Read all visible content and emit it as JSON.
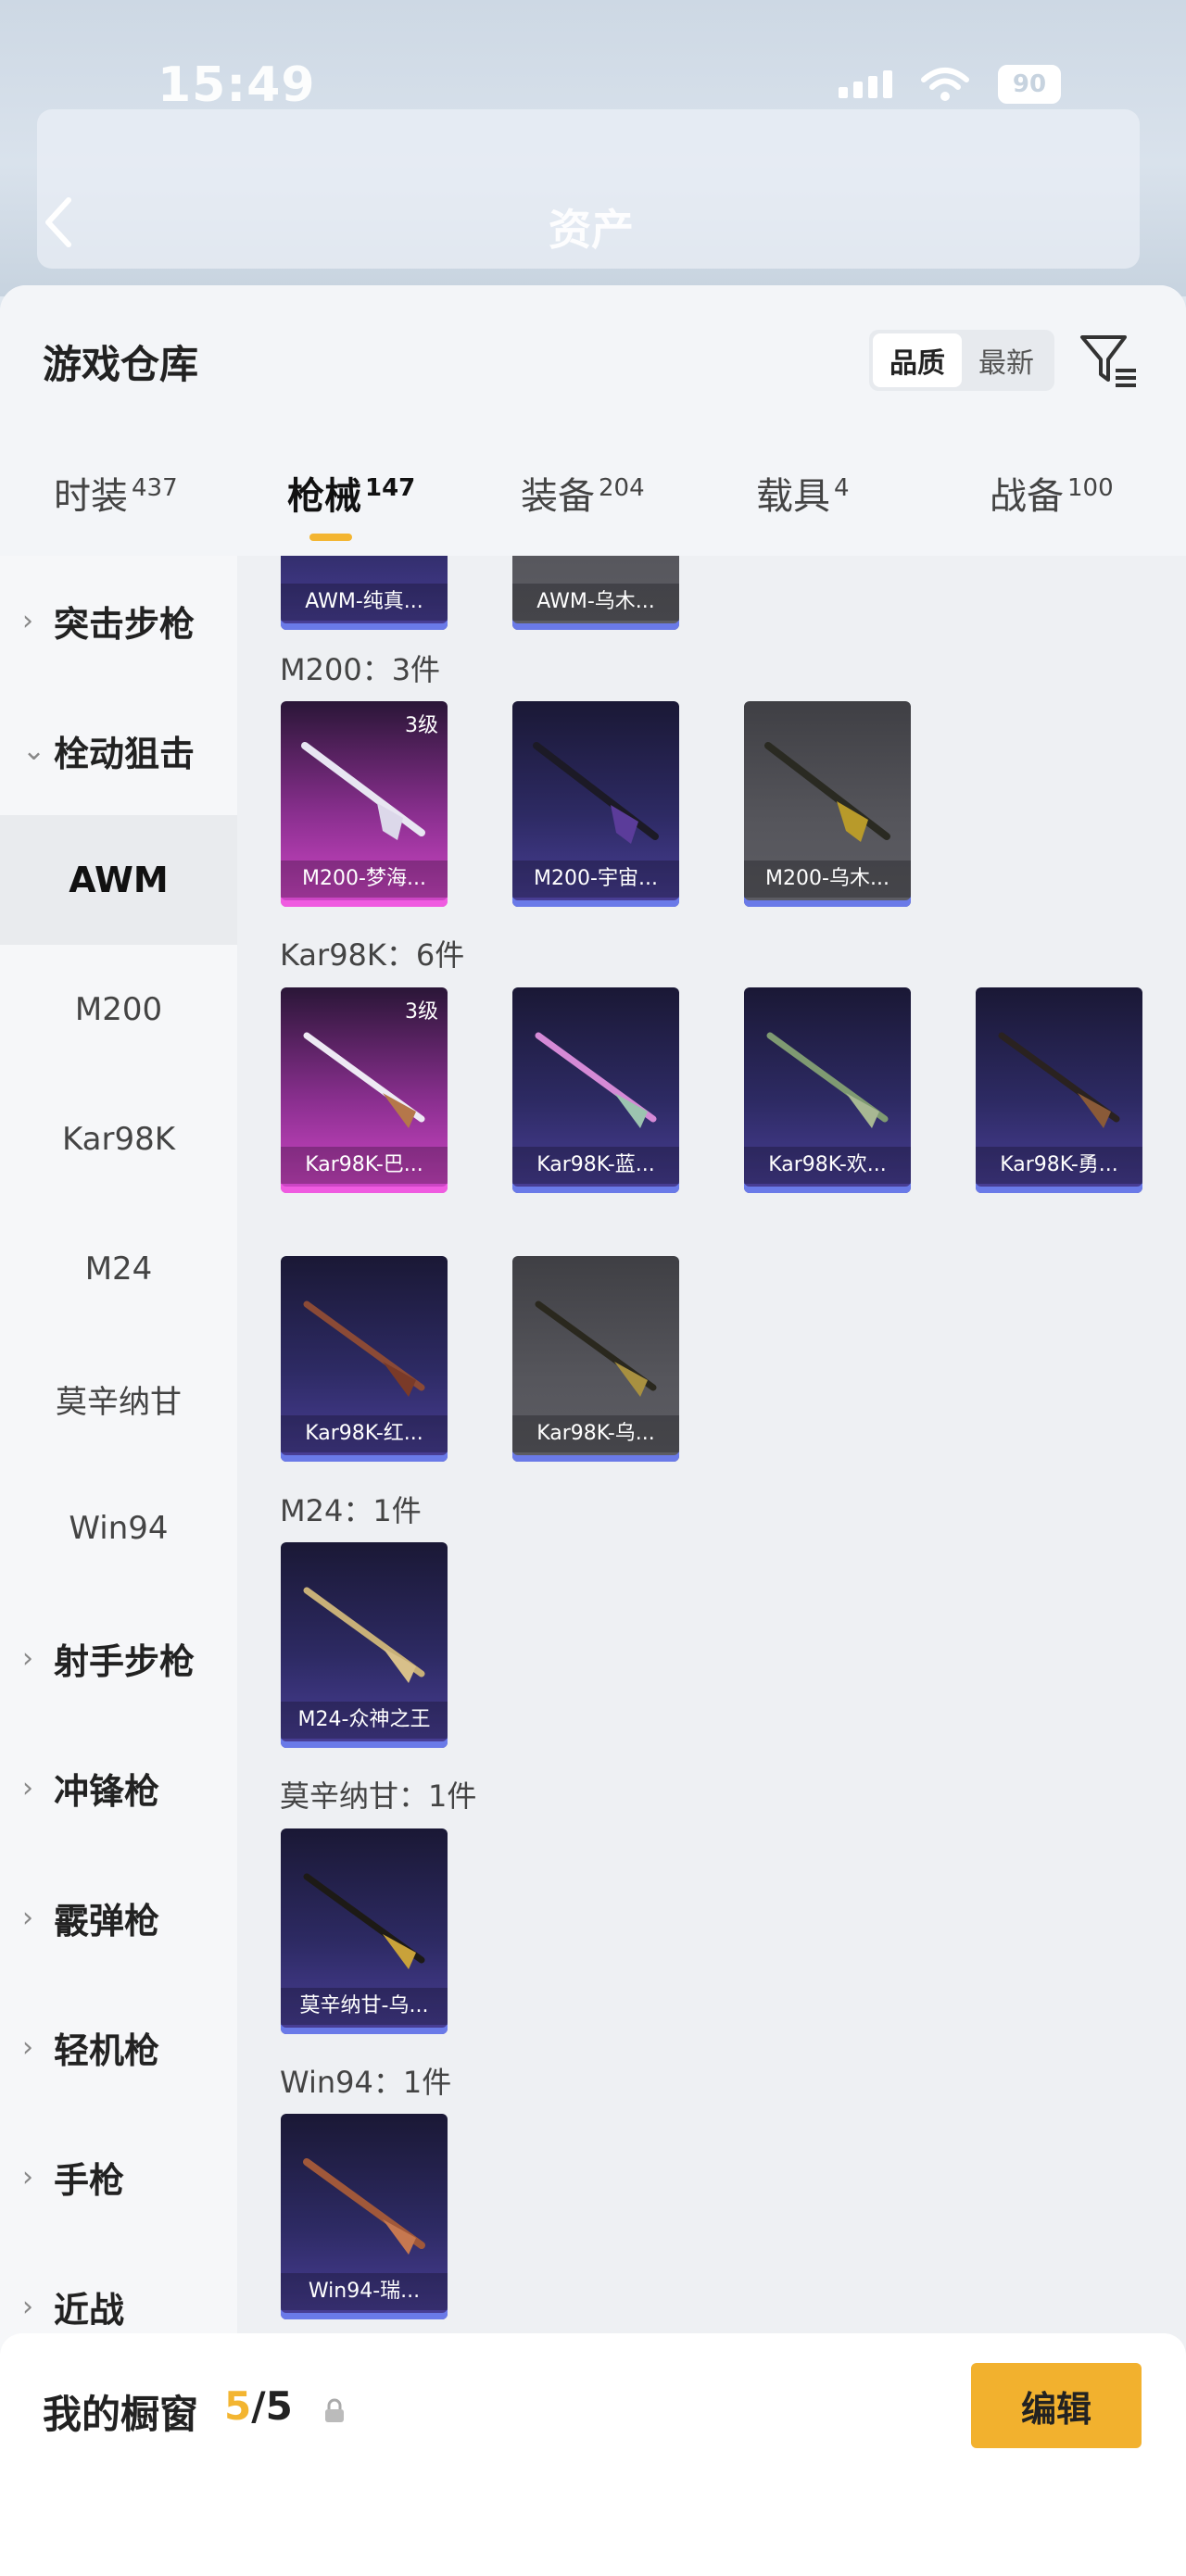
{
  "status_bar": {
    "time": "15:49",
    "battery": "90"
  },
  "nav": {
    "title": "资产"
  },
  "sheet": {
    "title": "游戏仓库"
  },
  "sort": {
    "options": [
      "品质",
      "最新"
    ],
    "active": "品质"
  },
  "tabs": [
    {
      "label": "时装",
      "count": "437"
    },
    {
      "label": "枪械",
      "count": "147",
      "active": true
    },
    {
      "label": "装备",
      "count": "204"
    },
    {
      "label": "载具",
      "count": "4"
    },
    {
      "label": "战备",
      "count": "100"
    }
  ],
  "sidebar": {
    "items": [
      {
        "label": "突击步枪",
        "type": "category",
        "expanded": false
      },
      {
        "label": "栓动狙击",
        "type": "category",
        "expanded": true
      },
      {
        "label": "AWM",
        "type": "sub",
        "selected": true
      },
      {
        "label": "M200",
        "type": "sub"
      },
      {
        "label": "Kar98K",
        "type": "sub"
      },
      {
        "label": "M24",
        "type": "sub"
      },
      {
        "label": "莫辛纳甘",
        "type": "sub"
      },
      {
        "label": "Win94",
        "type": "sub"
      },
      {
        "label": "射手步枪",
        "type": "category",
        "expanded": false
      },
      {
        "label": "冲锋枪",
        "type": "category",
        "expanded": false
      },
      {
        "label": "霰弹枪",
        "type": "category",
        "expanded": false
      },
      {
        "label": "轻机枪",
        "type": "category",
        "expanded": false
      },
      {
        "label": "手枪",
        "type": "category",
        "expanded": false
      },
      {
        "label": "近战",
        "type": "category",
        "expanded": false
      }
    ]
  },
  "content": {
    "partial_items": [
      {
        "name": "AWM-纯真...",
        "rarity": "purple"
      },
      {
        "name": "AWM-乌木...",
        "rarity": "grey"
      }
    ],
    "groups": [
      {
        "title": "M200：3件",
        "items": [
          {
            "name": "M200-梦海...",
            "rarity": "pink",
            "level": "3级"
          },
          {
            "name": "M200-宇宙...",
            "rarity": "purple"
          },
          {
            "name": "M200-乌木...",
            "rarity": "grey"
          }
        ]
      },
      {
        "title": "Kar98K：6件",
        "items": [
          {
            "name": "Kar98K-巴...",
            "rarity": "pink",
            "level": "3级"
          },
          {
            "name": "Kar98K-蓝...",
            "rarity": "purple"
          },
          {
            "name": "Kar98K-欢...",
            "rarity": "purple"
          },
          {
            "name": "Kar98K-勇...",
            "rarity": "purple"
          },
          {
            "name": "Kar98K-红...",
            "rarity": "purple"
          },
          {
            "name": "Kar98K-乌...",
            "rarity": "grey"
          }
        ]
      },
      {
        "title": "M24：1件",
        "items": [
          {
            "name": "M24-众神之王",
            "rarity": "purple"
          }
        ]
      },
      {
        "title": "莫辛纳甘：1件",
        "items": [
          {
            "name": "莫辛纳甘-乌...",
            "rarity": "purple"
          }
        ]
      },
      {
        "title": "Win94：1件",
        "items": [
          {
            "name": "Win94-瑞...",
            "rarity": "purple"
          }
        ]
      }
    ]
  },
  "showcase": {
    "label": "我的橱窗",
    "current": "5",
    "total": "/5"
  },
  "edit_button": {
    "label": "编辑"
  },
  "colors": {
    "accent": "#f3b531",
    "sheet_bg": "#f3f5f8",
    "content_bg": "#eef0f3"
  },
  "icons": [
    "back-icon",
    "filter-icon",
    "share-icon",
    "lock-icon",
    "chevron-right-icon",
    "chevron-down-icon"
  ]
}
